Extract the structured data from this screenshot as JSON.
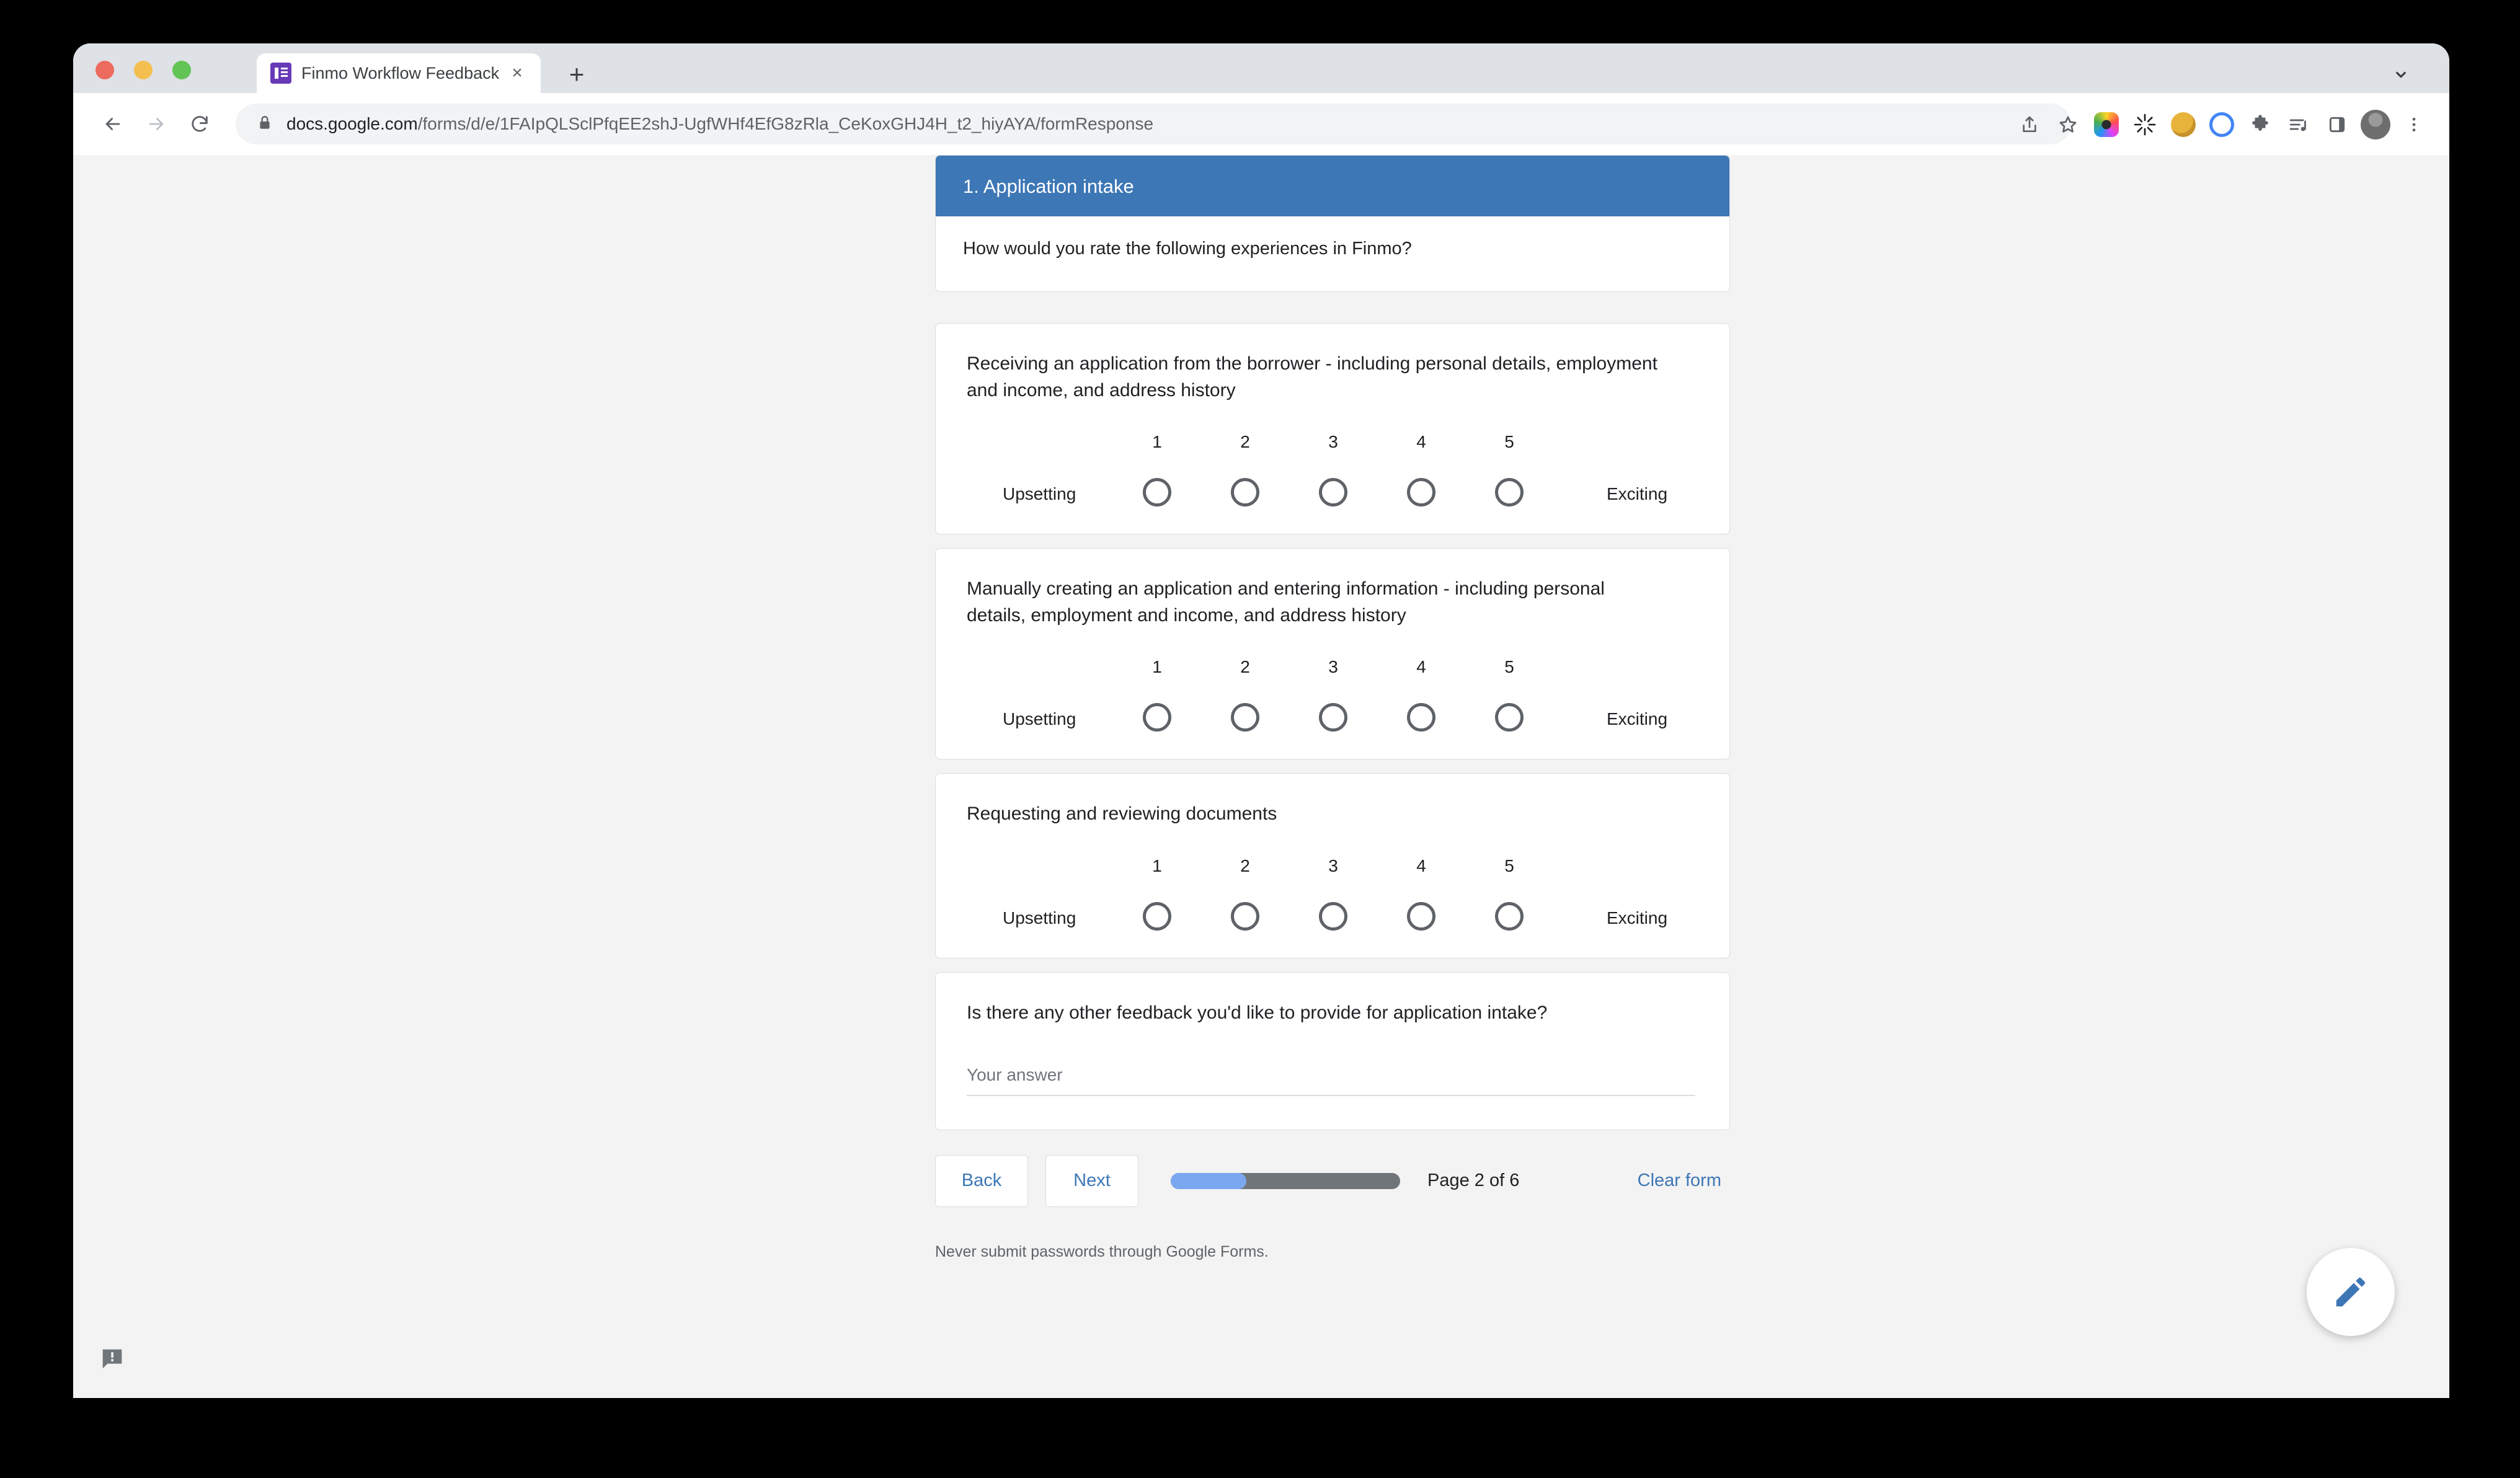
{
  "browser": {
    "tab": {
      "title": "Finmo Workflow Feedback",
      "favicon": "google-forms-icon",
      "close": "×"
    },
    "new_tab_label": "+",
    "url_secure_part": "docs.google.com",
    "url_path": "/forms/d/e/1FAIpQLSclPfqEE2shJ-UgfWHf4EfG8zRla_CeKoxGHJ4H_t2_hiyAYA/formResponse",
    "icons": {
      "back": "back-arrow-icon",
      "forward": "forward-arrow-icon",
      "reload": "reload-icon",
      "lock": "lock-icon",
      "share": "share-icon",
      "bookmark": "star-icon",
      "tab_list": "chevron-down-icon"
    }
  },
  "form": {
    "section": {
      "title": "1. Application intake",
      "description": "How would you rate the following experiences in Finmo?",
      "band_color": "#3d77b6"
    },
    "scale": {
      "columns": [
        "1",
        "2",
        "3",
        "4",
        "5"
      ],
      "low_label": "Upsetting",
      "high_label": "Exciting"
    },
    "questions": [
      {
        "title": "Receiving an application from the borrower - including personal details, employment and income, and address history"
      },
      {
        "title": "Manually creating an application and entering information - including personal details, employment and income, and address history"
      },
      {
        "title": "Requesting and reviewing documents"
      }
    ],
    "text_question": {
      "title": "Is there any other feedback you'd like to provide for application intake?",
      "placeholder": "Your answer",
      "value": ""
    },
    "footer": {
      "back_label": "Back",
      "next_label": "Next",
      "page_count": "Page 2 of 6",
      "clear_label": "Clear form",
      "progress_percent": 33,
      "progress_fill_color": "#7ba7f0",
      "progress_track_color": "#70757a"
    },
    "disclaimer": "Never submit passwords through Google Forms."
  },
  "overlays": {
    "feedback_icon": "feedback-report-icon",
    "fab_icon": "edit-pencil-icon"
  }
}
